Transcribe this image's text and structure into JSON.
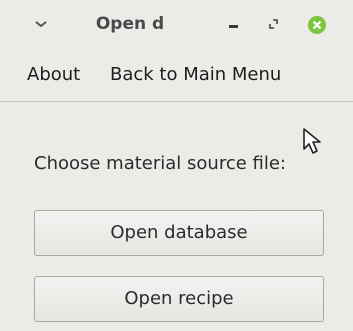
{
  "window": {
    "title": "Open d",
    "menu_icon": "chevron-down-icon",
    "minimize_icon": "minimize-icon",
    "maximize_icon": "maximize-icon",
    "close_icon": "close-icon",
    "close_color": "#7dc43f"
  },
  "menubar": {
    "items": [
      {
        "label": "About"
      },
      {
        "label": "Back to Main Menu"
      }
    ]
  },
  "main": {
    "prompt": "Choose material source file:",
    "buttons": [
      {
        "label": "Open database"
      },
      {
        "label": "Open recipe"
      }
    ]
  },
  "cursor": "arrow-cursor-icon"
}
